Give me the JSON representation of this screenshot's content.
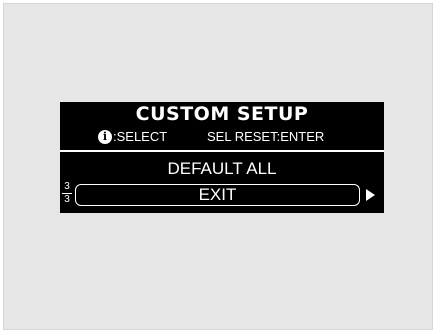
{
  "screen": {
    "title": "CUSTOM SETUP",
    "hint_left": ":SELECT",
    "hint_right": "SEL RESET:ENTER",
    "info_icon_glyph": "i",
    "menu": {
      "default_all_label": "DEFAULT ALL",
      "exit_label": "EXIT"
    },
    "page": {
      "current": "3",
      "total": "3"
    }
  },
  "icons": {
    "info": "info-icon",
    "next": "right-arrow-icon"
  },
  "colors": {
    "screen_background": "#000000",
    "screen_text": "#ffffff",
    "frame_background": "#e6e6e7"
  }
}
